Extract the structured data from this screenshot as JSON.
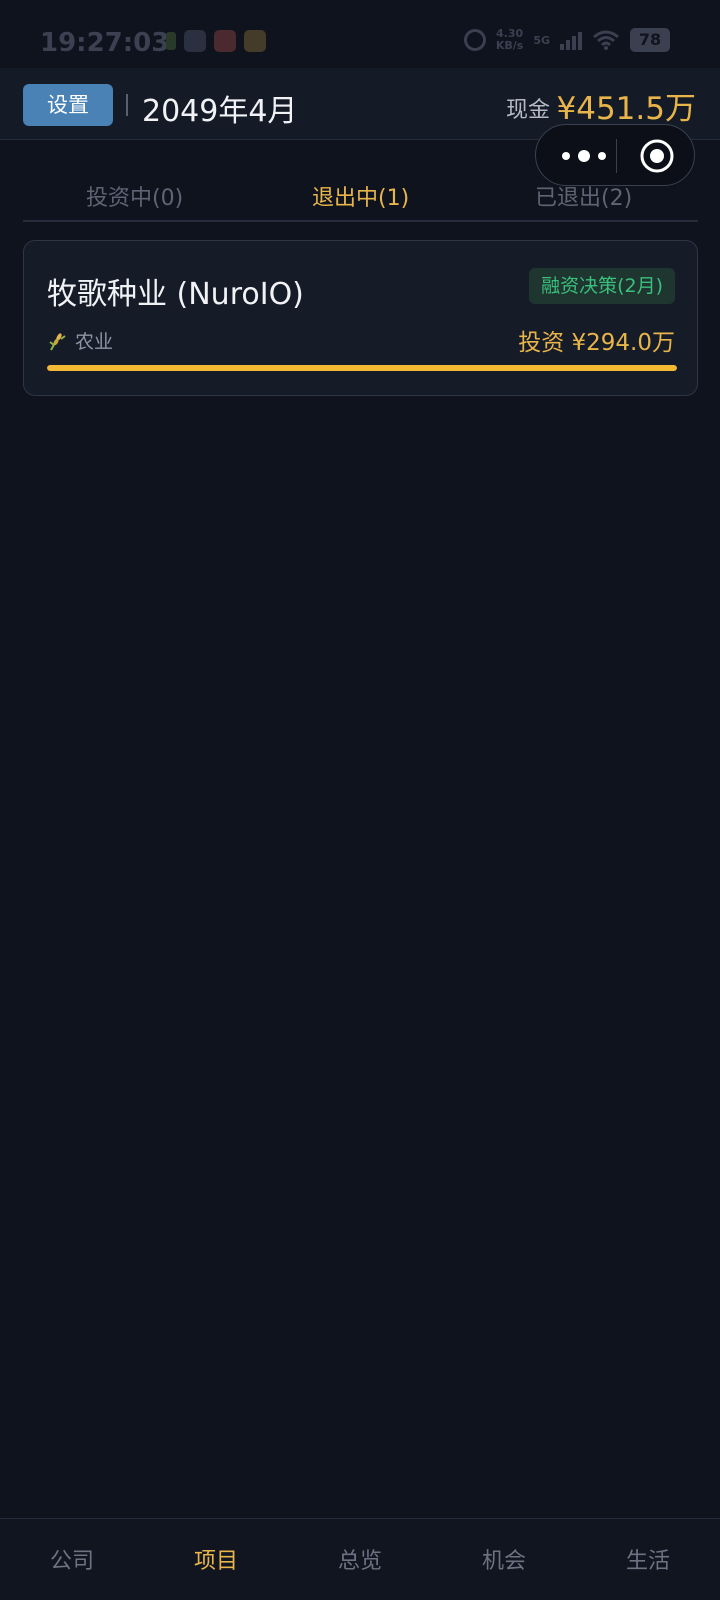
{
  "status_bar": {
    "time": "19:27:03",
    "net_speed_value": "4.30",
    "net_speed_unit": "KB/s",
    "network_type": "5G",
    "battery": "78"
  },
  "header": {
    "settings_label": "设置",
    "date": "2049年4月",
    "cash_label": "现金",
    "cash_value": "¥451.5万"
  },
  "tabs": [
    {
      "label": "投资中(0)",
      "active": false
    },
    {
      "label": "退出中(1)",
      "active": true
    },
    {
      "label": "已退出(2)",
      "active": false
    }
  ],
  "project": {
    "name": "牧歌种业 (NuroIO)",
    "status": "融资决策(2月)",
    "industry": "农业",
    "industry_icon": "wheat-icon",
    "investment": "投资 ¥294.0万",
    "progress": 1.0
  },
  "bottom_nav": [
    {
      "label": "公司",
      "active": false
    },
    {
      "label": "项目",
      "active": true
    },
    {
      "label": "总览",
      "active": false
    },
    {
      "label": "机会",
      "active": false
    },
    {
      "label": "生活",
      "active": false
    }
  ],
  "colors": {
    "accent": "#e8b54a",
    "background": "#0f131e",
    "badge_green": "#3bbf7c",
    "settings_blue": "#4a82b6"
  }
}
